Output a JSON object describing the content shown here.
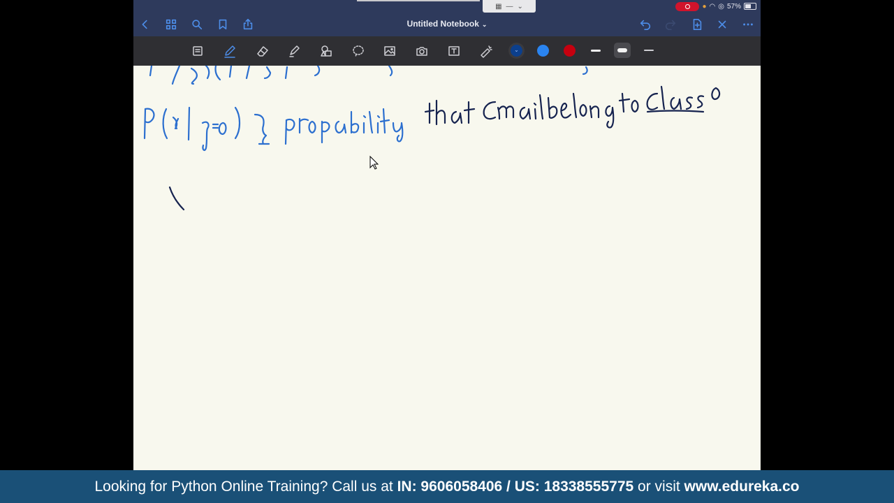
{
  "app": {
    "title": "Untitled Notebook",
    "battery": "57%"
  },
  "colors": {
    "accent": "#4d8de8",
    "swatch_dark_blue": "#0c3f8c",
    "swatch_blue": "#2a84f0",
    "swatch_red": "#c6000f",
    "ink_blue": "#2c6fcf",
    "ink_navy": "#16234f"
  },
  "toolbar": {
    "tools": [
      "lasso-select",
      "pen",
      "eraser",
      "highlighter",
      "shapes",
      "lasso",
      "image",
      "camera",
      "text",
      "laser-pointer"
    ]
  },
  "canvas": {
    "handwriting_line1": "P(x|y=0) } propability that email belong to class 0"
  },
  "banner": {
    "text1": "Looking for Python Online Training? Call us at ",
    "phone_label": "IN: 9606058406 / US: 18338555775",
    "text2": " or visit ",
    "site": "www.edureka.co"
  }
}
